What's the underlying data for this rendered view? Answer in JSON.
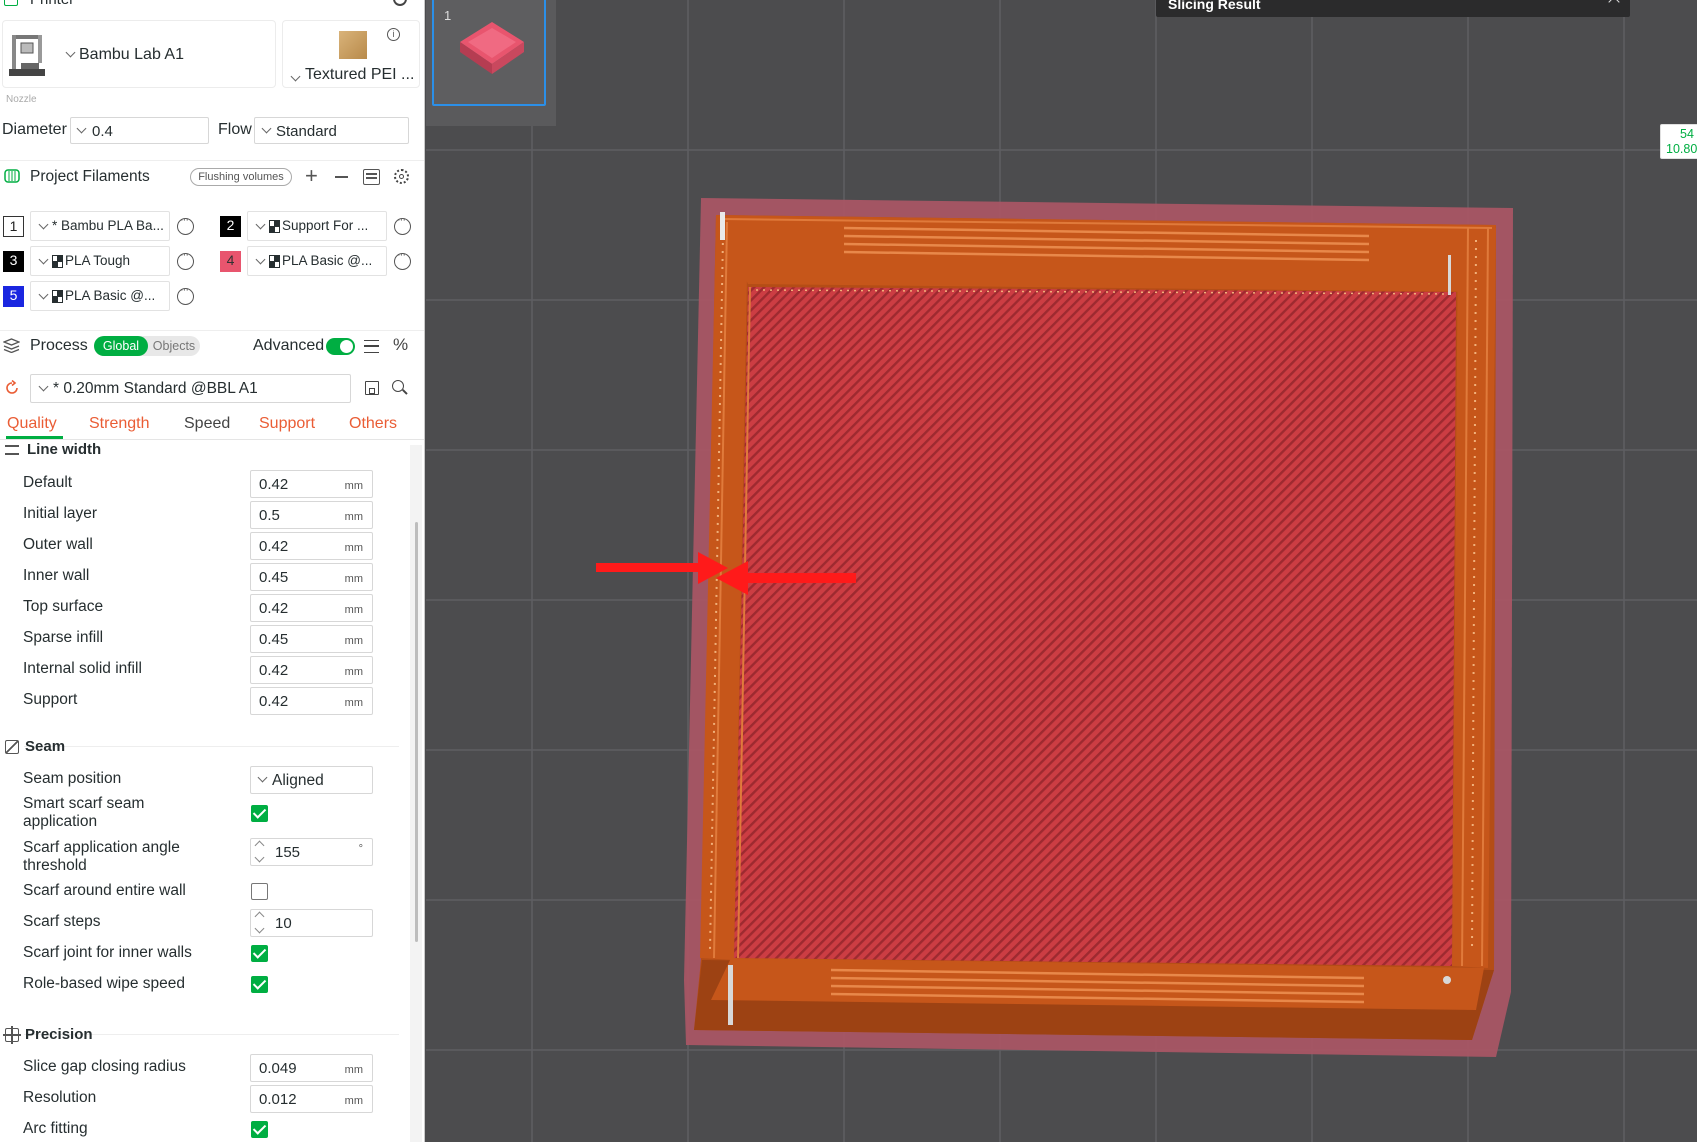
{
  "printer": {
    "section_title": "Printer",
    "model": "Bambu Lab A1",
    "plate": "Textured PEI ...",
    "nozzle_label": "Nozzle",
    "diameter_label": "Diameter",
    "diameter_value": "0.4",
    "flow_label": "Flow",
    "flow_value": "Standard"
  },
  "filaments": {
    "title": "Project Filaments",
    "flushing_button": "Flushing volumes",
    "items": [
      {
        "num": "1",
        "name": "* Bambu PLA Ba...",
        "color": "#ffffff"
      },
      {
        "num": "2",
        "name": "Support For ...",
        "color": "#000000"
      },
      {
        "num": "3",
        "name": "PLA Tough",
        "color": "#000000"
      },
      {
        "num": "4",
        "name": "PLA Basic @...",
        "color": "#e8556e"
      },
      {
        "num": "5",
        "name": "PLA Basic @...",
        "color": "#1a26e0"
      }
    ]
  },
  "process": {
    "title": "Process",
    "toggle_global": "Global",
    "toggle_objects": "Objects",
    "advanced_label": "Advanced",
    "preset": "* 0.20mm Standard @BBL A1",
    "tabs": [
      "Quality",
      "Strength",
      "Speed",
      "Support",
      "Others"
    ],
    "active_tab": "Quality"
  },
  "line_width": {
    "title": "Line width",
    "unit": "mm",
    "rows": [
      {
        "label": "Default",
        "value": "0.42"
      },
      {
        "label": "Initial layer",
        "value": "0.5"
      },
      {
        "label": "Outer wall",
        "value": "0.42"
      },
      {
        "label": "Inner wall",
        "value": "0.45"
      },
      {
        "label": "Top surface",
        "value": "0.42"
      },
      {
        "label": "Sparse infill",
        "value": "0.45"
      },
      {
        "label": "Internal solid infill",
        "value": "0.42"
      },
      {
        "label": "Support",
        "value": "0.42"
      }
    ]
  },
  "seam": {
    "title": "Seam",
    "position_label": "Seam position",
    "position_value": "Aligned",
    "smart_scarf_label": "Smart scarf seam application",
    "smart_scarf_checked": true,
    "scarf_angle_label": "Scarf application angle threshold",
    "scarf_angle_value": "155",
    "scarf_angle_unit": "°",
    "scarf_entire_label": "Scarf around entire wall",
    "scarf_entire_checked": false,
    "scarf_steps_label": "Scarf steps",
    "scarf_steps_value": "10",
    "scarf_inner_label": "Scarf joint for inner walls",
    "scarf_inner_checked": true,
    "role_wipe_label": "Role-based wipe speed",
    "role_wipe_checked": true
  },
  "precision": {
    "title": "Precision",
    "unit": "mm",
    "gap_label": "Slice gap closing radius",
    "gap_value": "0.049",
    "resolution_label": "Resolution",
    "resolution_value": "0.012",
    "arc_label": "Arc fitting",
    "arc_checked": true
  },
  "viewport": {
    "plate_number": "1",
    "slicing_result": "Slicing Result",
    "layer_readout_top": "54",
    "layer_readout_bottom": "10.80"
  },
  "colors": {
    "accent": "#00ae42",
    "tab_orange": "#ea5d35",
    "model_orange": "#c6561a",
    "model_red": "#cc3d43",
    "plate_pink": "#a85564",
    "arrow_red": "#ff1a1a"
  }
}
